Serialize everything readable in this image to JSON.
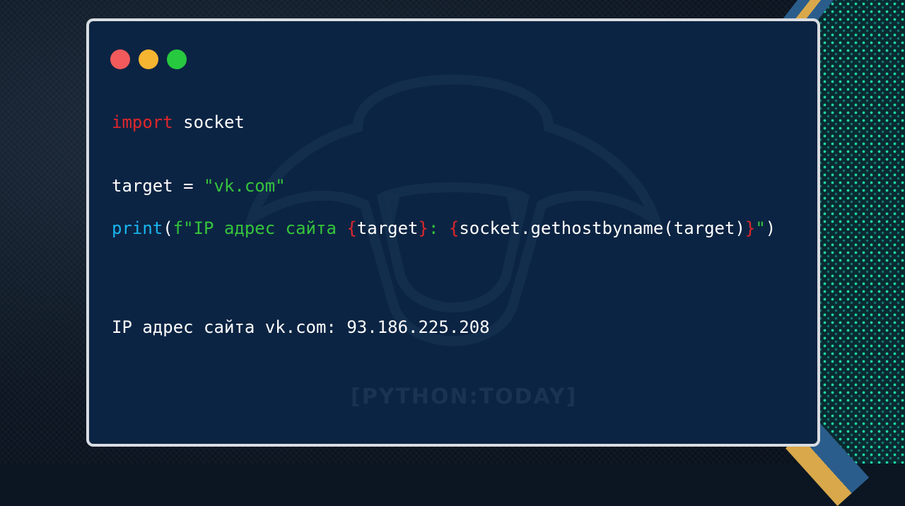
{
  "window": {
    "controls": [
      {
        "name": "close",
        "color": "#f25a5b"
      },
      {
        "name": "minimize",
        "color": "#f5b531"
      },
      {
        "name": "maximize",
        "color": "#27c93f"
      }
    ]
  },
  "code": {
    "line1": {
      "keyword": "import",
      "module": " socket"
    },
    "line2": {
      "var": "target = ",
      "string": "\"vk.com\""
    },
    "line3": {
      "func": "print",
      "open_paren": "(",
      "fstring_start": "f\"IP адрес сайта ",
      "brace1_open": "{",
      "expr1": "target",
      "brace1_close": "}",
      "sep": ": ",
      "brace2_open": "{",
      "expr2": "socket.gethostbyname(target)",
      "brace2_close": "}",
      "fstring_end": "\"",
      "close_paren": ")"
    }
  },
  "output": {
    "text": "IP адрес сайта vk.com: 93.186.225.208"
  },
  "watermark": {
    "text": "[PYTHON:TODAY]"
  },
  "colors": {
    "card_bg": "#0c2443",
    "keyword": "#e0262c",
    "function": "#19b6f0",
    "string": "#35c43b",
    "text": "#ffffff"
  }
}
